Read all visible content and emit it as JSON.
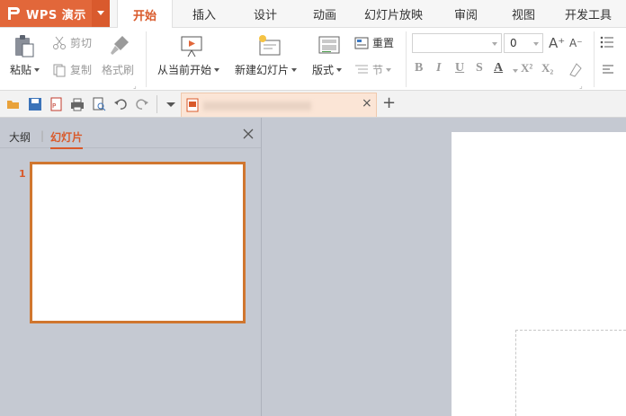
{
  "app": {
    "title": "WPS 演示"
  },
  "tabs": [
    {
      "label": "开始",
      "active": true
    },
    {
      "label": "插入"
    },
    {
      "label": "设计"
    },
    {
      "label": "动画"
    },
    {
      "label": "幻灯片放映"
    },
    {
      "label": "审阅"
    },
    {
      "label": "视图"
    },
    {
      "label": "开发工具"
    }
  ],
  "ribbon": {
    "paste": "粘贴",
    "cut": "剪切",
    "copy": "复制",
    "format_painter": "格式刷",
    "from_current": "从当前开始",
    "new_slide": "新建幻灯片",
    "layout": "版式",
    "reset": "重置",
    "section": "节",
    "font_size": "0",
    "bold": "B",
    "italic": "I",
    "underline": "U",
    "strike": "S",
    "font_color": "A",
    "superscript": "X²",
    "subscript": "X₂",
    "grow_font": "A⁺",
    "shrink_font": "A⁻"
  },
  "panel": {
    "tab_outline": "大纲",
    "tab_slides": "幻灯片",
    "slide_number": "1"
  },
  "colors": {
    "accent": "#e2673a",
    "active_tab_text": "#d9592a",
    "thumb_border": "#d0762f"
  }
}
